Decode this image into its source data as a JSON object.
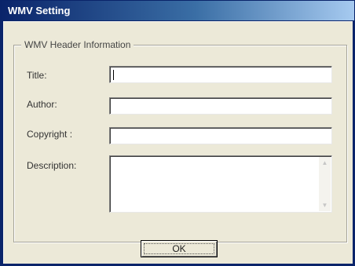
{
  "window": {
    "title": "WMV Setting"
  },
  "group": {
    "legend": "WMV Header Information"
  },
  "fields": {
    "title_label": "Title:",
    "title_value": "",
    "author_label": "Author:",
    "author_value": "",
    "copyright_label": "Copyright :",
    "copyright_value": "",
    "description_label": "Description:",
    "description_value": ""
  },
  "buttons": {
    "ok_label": "OK"
  },
  "icons": {
    "scroll_up": "scroll-up-arrow",
    "scroll_down": "scroll-down-arrow"
  },
  "colors": {
    "titlebar_start": "#0a246a",
    "titlebar_end": "#a6caf0",
    "dialog_bg": "#ece9d8"
  }
}
